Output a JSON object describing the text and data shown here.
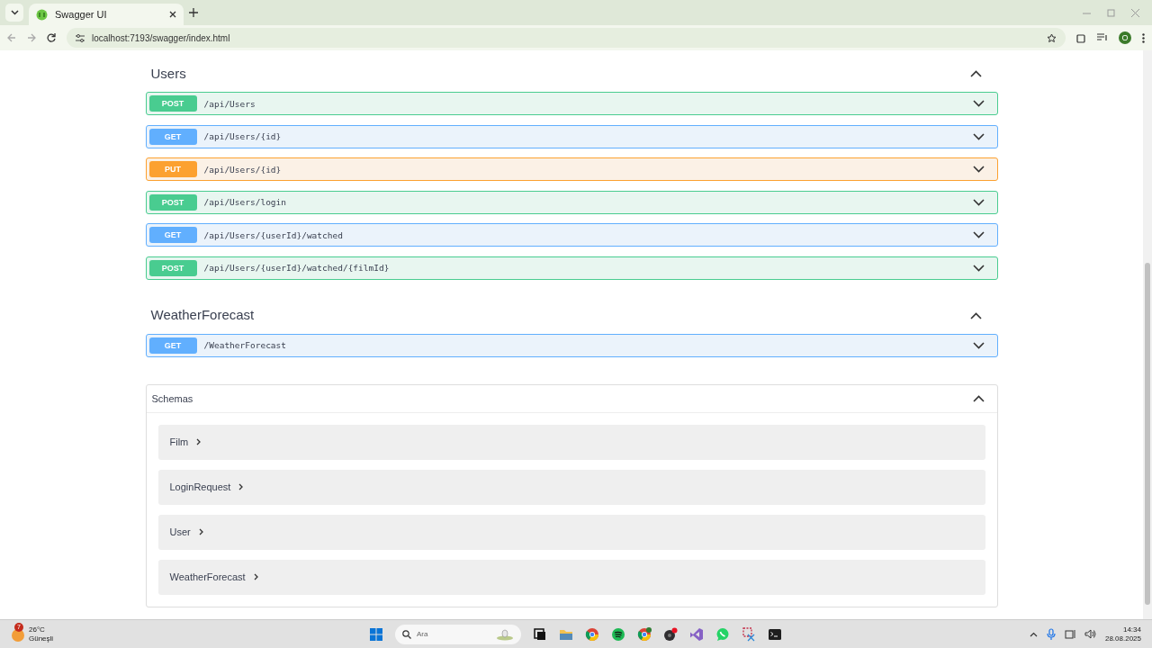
{
  "browser": {
    "tab_title": "Swagger UI",
    "url": "localhost:7193/swagger/index.html",
    "profile_initial": "O"
  },
  "sections": [
    {
      "name": "Users",
      "expanded": true,
      "operations": [
        {
          "method": "POST",
          "path": "/api/Users"
        },
        {
          "method": "GET",
          "path": "/api/Users/{id}"
        },
        {
          "method": "PUT",
          "path": "/api/Users/{id}"
        },
        {
          "method": "POST",
          "path": "/api/Users/login"
        },
        {
          "method": "GET",
          "path": "/api/Users/{userId}/watched"
        },
        {
          "method": "POST",
          "path": "/api/Users/{userId}/watched/{filmId}"
        }
      ]
    },
    {
      "name": "WeatherForecast",
      "expanded": true,
      "operations": [
        {
          "method": "GET",
          "path": "/WeatherForecast"
        }
      ]
    }
  ],
  "schemas": {
    "title": "Schemas",
    "expanded": true,
    "models": [
      "Film",
      "LoginRequest",
      "User",
      "WeatherForecast"
    ]
  },
  "taskbar": {
    "weather_badge": "7",
    "temperature": "26°C",
    "condition": "Güneşli",
    "search_placeholder": "Ara",
    "time": "14:34",
    "date": "28.08.2025"
  }
}
